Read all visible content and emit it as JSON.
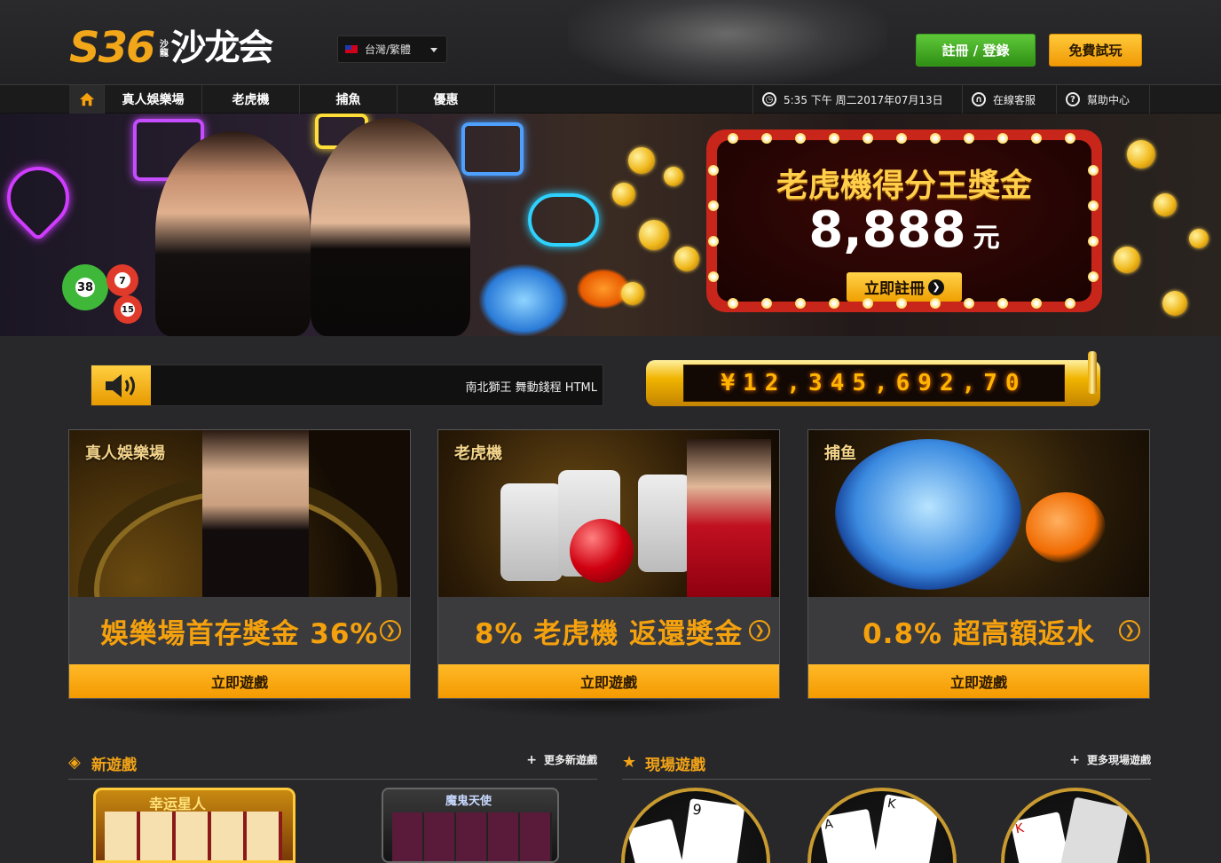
{
  "brand": {
    "logo_mark": "S36",
    "logo_vertical": "沙龍",
    "logo_name": "沙龙会"
  },
  "language": {
    "selected": "台灣/繁體"
  },
  "header_buttons": {
    "login": "註冊 / 登錄",
    "trial": "免費試玩"
  },
  "nav": {
    "items": [
      {
        "label": "真人娛樂場"
      },
      {
        "label": "老虎機"
      },
      {
        "label": "捕魚"
      },
      {
        "label": "優惠"
      }
    ],
    "datetime": "5:35 下午 周二2017年07月13日",
    "support": "在線客服",
    "help": "幫助中心"
  },
  "banner": {
    "promo_title": "老虎機得分王獎金",
    "promo_amount": "8,888",
    "promo_unit": "元",
    "promo_button": "立即註冊",
    "ball_numbers": [
      "38",
      "7",
      "15"
    ]
  },
  "marquee": {
    "text": "南北獅王 舞動錢程 HTML"
  },
  "jackpot": {
    "display": "¥12,345,692,70"
  },
  "cards": [
    {
      "category": "真人娛樂場",
      "slogan": "娛樂場首存獎金 36%",
      "button": "立即遊戲"
    },
    {
      "category": "老虎機",
      "slogan": "8% 老虎機 返還獎金",
      "button": "立即遊戲"
    },
    {
      "category": "捕鱼",
      "slogan": "0.8% 超高額返水",
      "button": "立即遊戲"
    }
  ],
  "sections": {
    "new_games": {
      "title": "新遊戲",
      "more": "更多新遊戲",
      "icon": "diamond-icon"
    },
    "live_games": {
      "title": "現場遊戲",
      "more": "更多現場遊戲",
      "icon": "star-icon"
    }
  },
  "thumb_labels": {
    "g1": "幸运星人",
    "g2": "魔鬼天使"
  },
  "colors": {
    "accent": "#f5a10d",
    "login_green": "#3fa820",
    "background": "#28282a"
  }
}
